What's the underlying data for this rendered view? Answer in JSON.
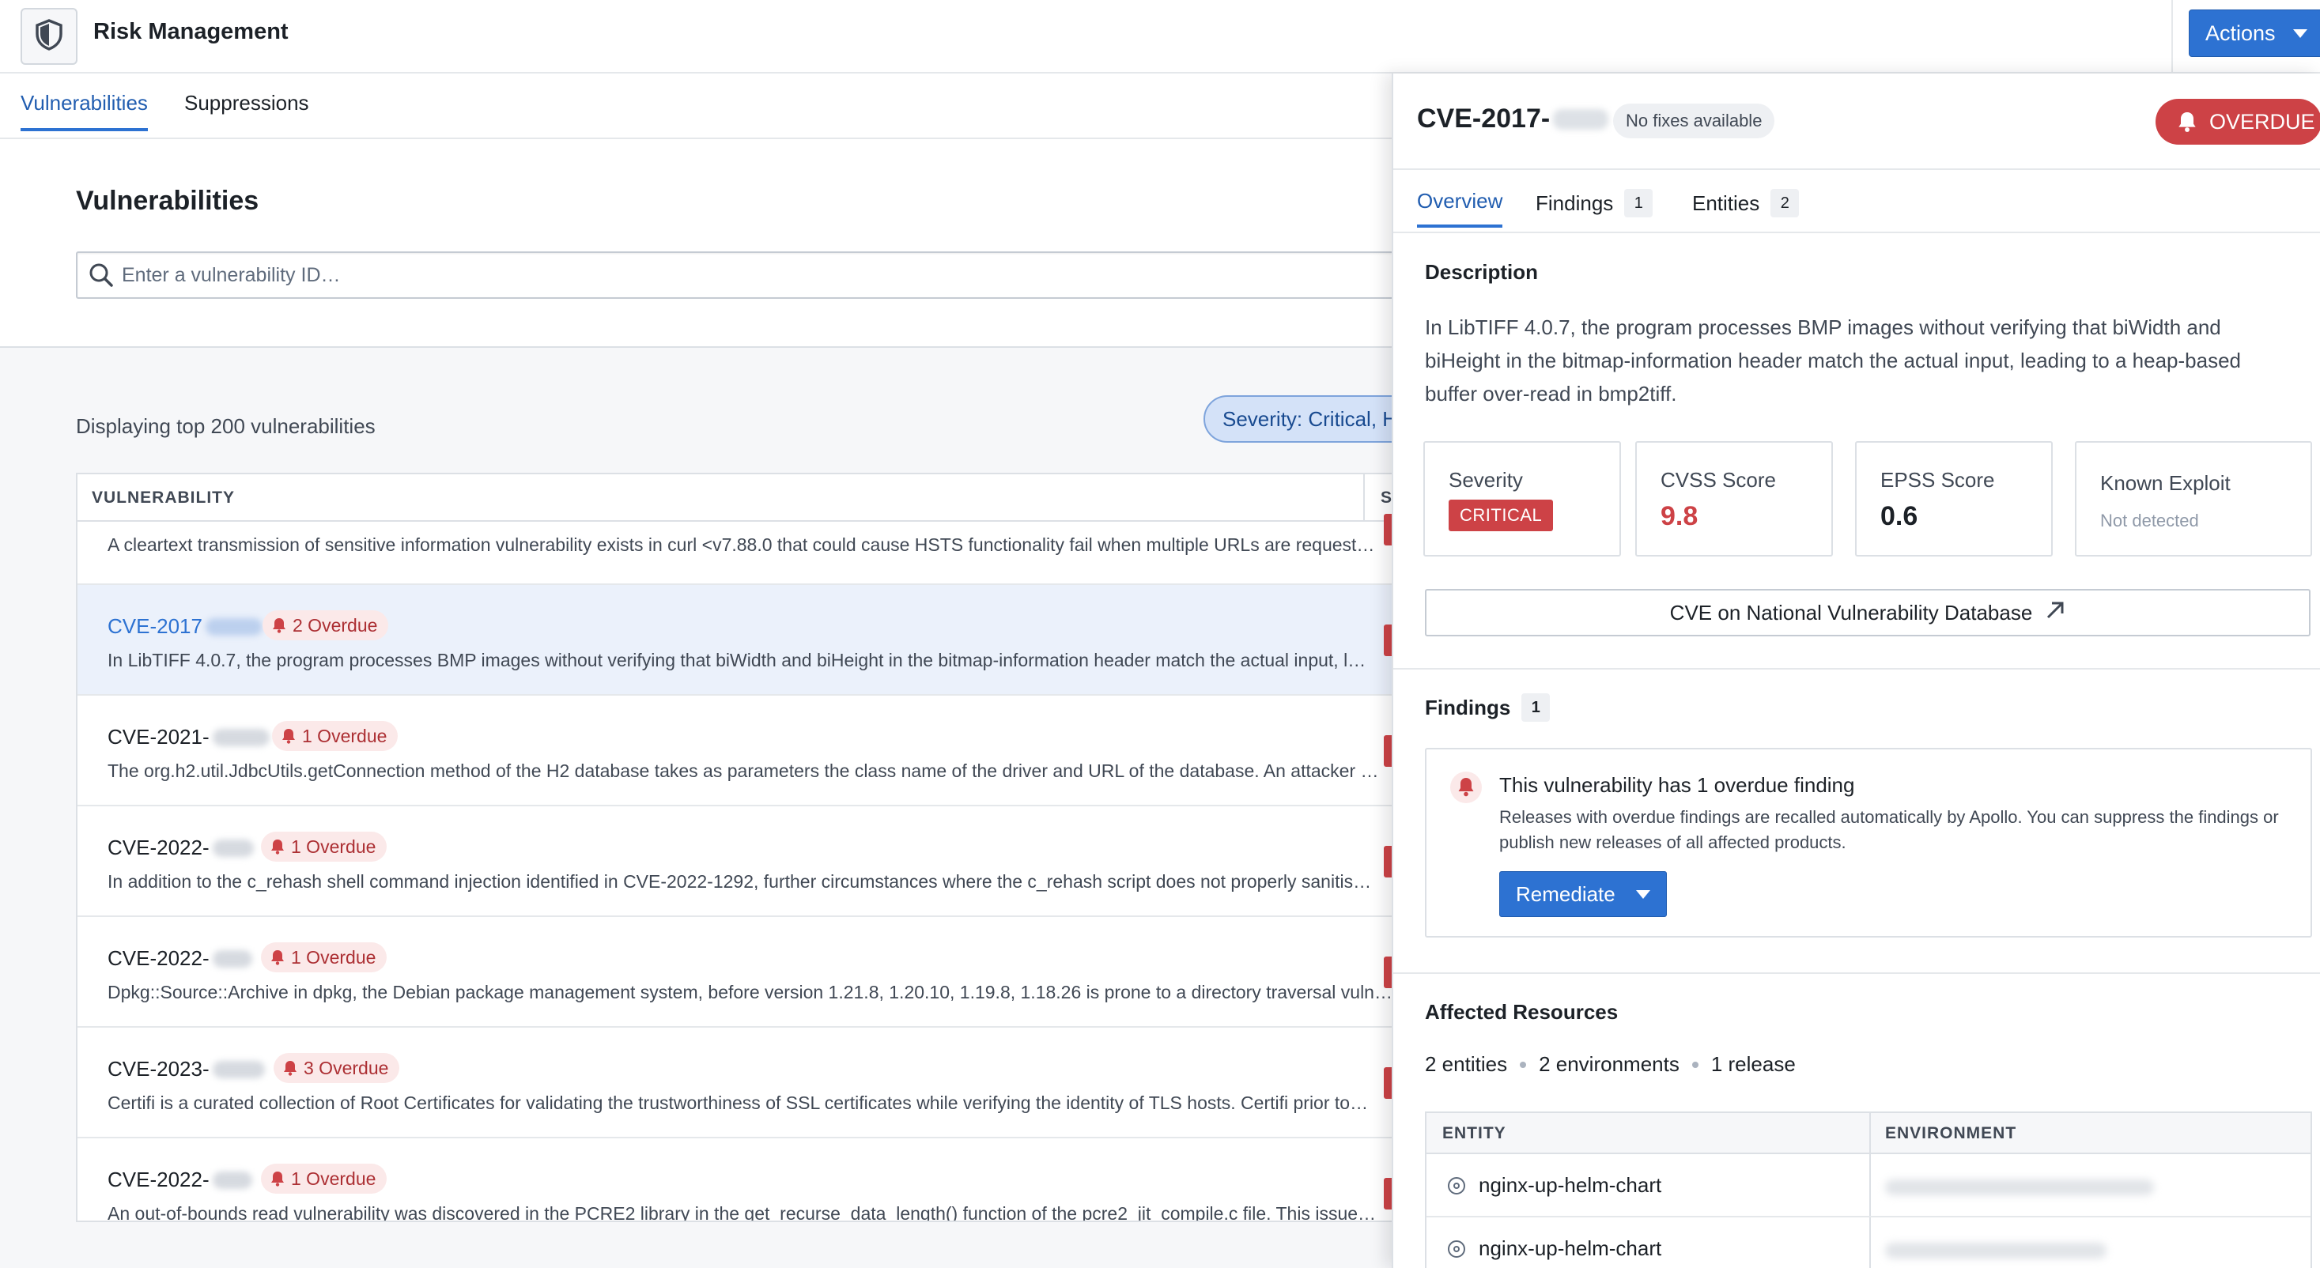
{
  "app": {
    "title": "Risk Management",
    "logo_icon": "shield-icon",
    "actions_label": "Actions"
  },
  "tabs": [
    {
      "label": "Vulnerabilities",
      "active": true
    },
    {
      "label": "Suppressions",
      "active": false
    }
  ],
  "vulnerabilities": {
    "title": "Vulnerabilities",
    "search_placeholder": "Enter a vulnerability ID…",
    "display_label": "Displaying top 200 vulnerabilities",
    "severity_filter": "Severity: Critical, H",
    "column_header": "VULNERABILITY",
    "column_header_2": "S",
    "rows": [
      {
        "id": "",
        "overdue": "",
        "description": "A cleartext transmission of sensitive information vulnerability exists in curl <v7.88.0 that could cause HSTS functionality fail when multiple URLs are request…",
        "selected": false
      },
      {
        "id": "CVE-2017",
        "overdue": "2 Overdue",
        "description": "In LibTIFF 4.0.7, the program processes BMP images without verifying that biWidth and biHeight in the bitmap-information header match the actual input, l…",
        "selected": true
      },
      {
        "id": "CVE-2021-",
        "overdue": "1 Overdue",
        "description": "The org.h2.util.JdbcUtils.getConnection method of the H2 database takes as parameters the class name of the driver and URL of the database. An attacker …",
        "selected": false
      },
      {
        "id": "CVE-2022-",
        "overdue": "1 Overdue",
        "description": "In addition to the c_rehash shell command injection identified in CVE-2022-1292, further circumstances where the c_rehash script does not properly sanitis…",
        "selected": false
      },
      {
        "id": "CVE-2022-",
        "overdue": "1 Overdue",
        "description": "Dpkg::Source::Archive in dpkg, the Debian package management system, before version 1.21.8, 1.20.10, 1.19.8, 1.18.26 is prone to a directory traversal vuln…",
        "selected": false
      },
      {
        "id": "CVE-2023-",
        "overdue": "3 Overdue",
        "description": "Certifi is a curated collection of Root Certificates for validating the trustworthiness of SSL certificates while verifying the identity of TLS hosts. Certifi prior to…",
        "selected": false
      },
      {
        "id": "CVE-2022-",
        "overdue": "1 Overdue",
        "description": "An out-of-bounds read vulnerability was discovered in the PCRE2 library in the get_recurse_data_length() function of the pcre2_jit_compile.c file. This issue…",
        "selected": false
      }
    ]
  },
  "panel": {
    "title": "CVE-2017-",
    "fix_status": "No fixes available",
    "overdue_badge": "OVERDUE",
    "tabs": [
      {
        "label": "Overview",
        "count": "",
        "active": true
      },
      {
        "label": "Findings",
        "count": "1",
        "active": false
      },
      {
        "label": "Entities",
        "count": "2",
        "active": false
      }
    ],
    "description_title": "Description",
    "description": "In LibTIFF 4.0.7, the program processes BMP images without verifying that biWidth and biHeight in the bitmap-information header match the actual input, leading to a heap-based buffer over-read in bmp2tiff.",
    "severity_label": "Severity",
    "severity_value": "CRITICAL",
    "cvss_label": "CVSS Score",
    "cvss_value": "9.8",
    "epss_label": "EPSS Score",
    "epss_value": "0.6",
    "exploit_label": "Known Exploit",
    "exploit_value": "Not detected",
    "nvd_link": "CVE on National Vulnerability Database",
    "findings_title": "Findings",
    "findings_count": "1",
    "finding_headline": "This vulnerability has 1 overdue finding",
    "finding_body": "Releases with overdue findings are recalled automatically by Apollo. You can suppress the findings or publish new releases of all affected products.",
    "remediate_label": "Remediate",
    "affected_title": "Affected Resources",
    "affected_stats": {
      "entities": "2 entities",
      "environments": "2 environments",
      "releases": "1 release"
    },
    "resource_headers": {
      "entity": "ENTITY",
      "environment": "ENVIRONMENT"
    },
    "resources": [
      {
        "entity": "nginx-up-helm-chart"
      },
      {
        "entity": "nginx-up-helm-chart"
      }
    ]
  },
  "colors": {
    "accent": "#2d72d2",
    "danger": "#cd4246",
    "danger_bg": "#fbe9e9",
    "selected_row": "#ebf1fb"
  }
}
